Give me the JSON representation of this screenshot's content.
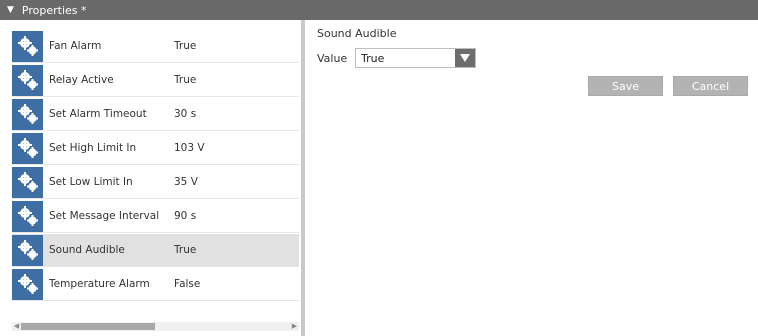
{
  "window": {
    "title": "Properties *",
    "collapse_icon": "triangle-down-icon"
  },
  "properties": [
    {
      "name": "Fan Alarm",
      "value": "True",
      "icon": "gears-icon"
    },
    {
      "name": "Relay Active",
      "value": "True",
      "icon": "gears-icon"
    },
    {
      "name": "Set Alarm Timeout",
      "value": "30 s",
      "icon": "gears-icon"
    },
    {
      "name": "Set High Limit In",
      "value": "103 V",
      "icon": "gears-icon"
    },
    {
      "name": "Set Low Limit In",
      "value": "35 V",
      "icon": "gears-icon"
    },
    {
      "name": "Set Message Interval",
      "value": "90 s",
      "icon": "gears-icon"
    },
    {
      "name": "Sound Audible",
      "value": "True",
      "icon": "gears-icon",
      "selected": true
    },
    {
      "name": "Temperature Alarm",
      "value": "False",
      "icon": "gears-icon"
    }
  ],
  "editor": {
    "title": "Sound Audible",
    "value_label": "Value",
    "selected_value": "True",
    "save_label": "Save",
    "cancel_label": "Cancel"
  },
  "colors": {
    "titlebar": "#6a6a6a",
    "icon_tile": "#3f6ea5",
    "selected_row": "#e1e1e1",
    "button": "#b3b3b3"
  }
}
